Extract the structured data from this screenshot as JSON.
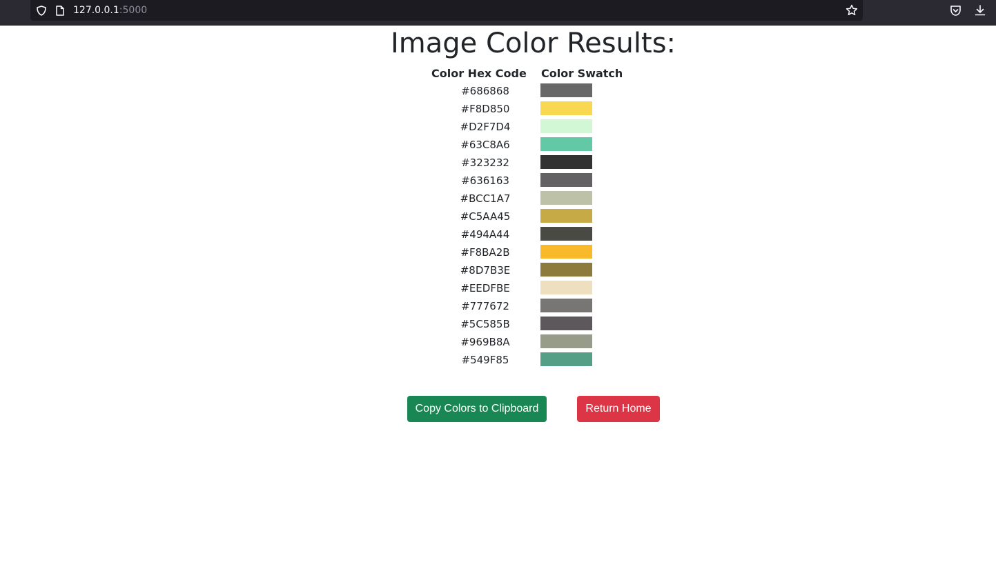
{
  "browser": {
    "url_host": "127.0.0.1",
    "url_port": ":5000"
  },
  "page": {
    "title": "Image Color Results:",
    "table": {
      "headers": {
        "hex": "Color Hex Code",
        "swatch": "Color Swatch"
      },
      "colors": [
        {
          "hex": "#686868",
          "swatch": "#686868"
        },
        {
          "hex": "#F8D850",
          "swatch": "#F8D850"
        },
        {
          "hex": "#D2F7D4",
          "swatch": "#D2F7D4"
        },
        {
          "hex": "#63C8A6",
          "swatch": "#63C8A6"
        },
        {
          "hex": "#323232",
          "swatch": "#323232"
        },
        {
          "hex": "#636163",
          "swatch": "#636163"
        },
        {
          "hex": "#BCC1A7",
          "swatch": "#BCC1A7"
        },
        {
          "hex": "#C5AA45",
          "swatch": "#C5AA45"
        },
        {
          "hex": "#494A44",
          "swatch": "#494A44"
        },
        {
          "hex": "#F8BA2B",
          "swatch": "#F8BA2B"
        },
        {
          "hex": "#8D7B3E",
          "swatch": "#8D7B3E"
        },
        {
          "hex": "#EEDFBE",
          "swatch": "#EEDFBE"
        },
        {
          "hex": "#777672",
          "swatch": "#777672"
        },
        {
          "hex": "#5C585B",
          "swatch": "#5C585B"
        },
        {
          "hex": "#969B8A",
          "swatch": "#969B8A"
        },
        {
          "hex": "#549F85",
          "swatch": "#549F85"
        }
      ]
    },
    "buttons": {
      "copy_label": "Copy Colors to Clipboard",
      "home_label": "Return Home"
    }
  },
  "colors": {
    "copy_button": "#198754",
    "home_button": "#DC3545",
    "chrome_bg": "#2B2A33",
    "urlbar_bg": "#1C1B22"
  }
}
